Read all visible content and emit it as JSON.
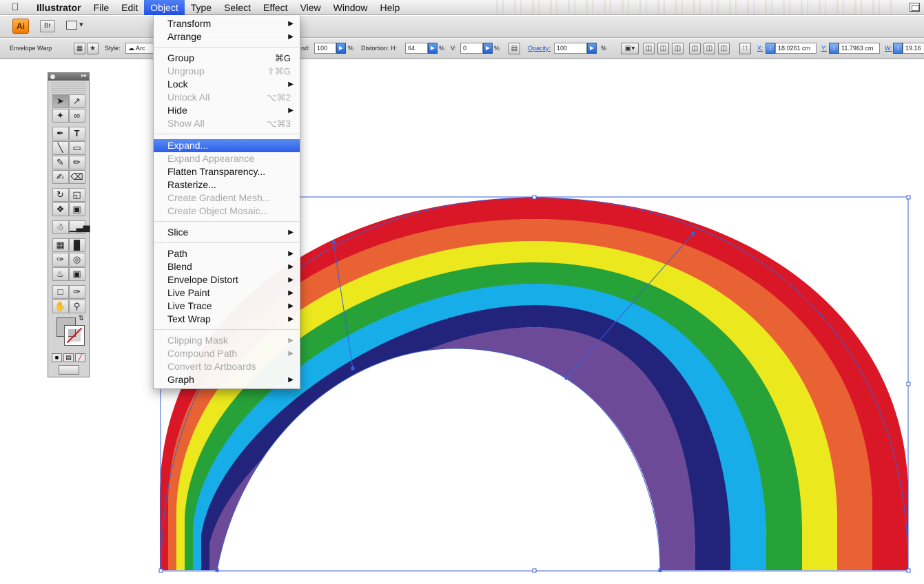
{
  "menubar": {
    "app_name": "Illustrator",
    "items": [
      "File",
      "Edit",
      "Object",
      "Type",
      "Select",
      "Effect",
      "View",
      "Window",
      "Help"
    ],
    "active": "Object"
  },
  "appbar": {
    "ai_label": "Ai",
    "bridge_label": "Br"
  },
  "controlbar": {
    "mode_label": "Envelope Warp",
    "style_label": "Style:",
    "style_value": "Arc",
    "bend_label": "nd:",
    "bend_value": "100",
    "distortion_h_label": "Distortion: H:",
    "distortion_h_value": "64",
    "v_label": "V:",
    "v_value": "0",
    "opacity_label": "Opacity:",
    "opacity_value": "100",
    "percent": "%",
    "x_label": "X:",
    "x_value": "18.0261 cm",
    "y_label": "Y:",
    "y_value": "11.7963 cm",
    "w_label": "W:",
    "w_value": "19.16"
  },
  "object_menu": {
    "items": [
      {
        "label": "Transform",
        "shortcut": "",
        "submenu": true,
        "disabled": false
      },
      {
        "label": "Arrange",
        "shortcut": "",
        "submenu": true,
        "disabled": false
      },
      {
        "label": "Group",
        "shortcut": "⌘G",
        "submenu": false,
        "disabled": false
      },
      {
        "label": "Ungroup",
        "shortcut": "⇧⌘G",
        "submenu": false,
        "disabled": true
      },
      {
        "label": "Lock",
        "shortcut": "",
        "submenu": true,
        "disabled": false
      },
      {
        "label": "Unlock All",
        "shortcut": "⌥⌘2",
        "submenu": false,
        "disabled": true
      },
      {
        "label": "Hide",
        "shortcut": "",
        "submenu": true,
        "disabled": false
      },
      {
        "label": "Show All",
        "shortcut": "⌥⌘3",
        "submenu": false,
        "disabled": true
      },
      {
        "label": "Expand...",
        "shortcut": "",
        "submenu": false,
        "disabled": false,
        "highlighted": true
      },
      {
        "label": "Expand Appearance",
        "shortcut": "",
        "submenu": false,
        "disabled": true
      },
      {
        "label": "Flatten Transparency...",
        "shortcut": "",
        "submenu": false,
        "disabled": false
      },
      {
        "label": "Rasterize...",
        "shortcut": "",
        "submenu": false,
        "disabled": false
      },
      {
        "label": "Create Gradient Mesh...",
        "shortcut": "",
        "submenu": false,
        "disabled": true
      },
      {
        "label": "Create Object Mosaic...",
        "shortcut": "",
        "submenu": false,
        "disabled": true
      },
      {
        "label": "Slice",
        "shortcut": "",
        "submenu": true,
        "disabled": false
      },
      {
        "label": "Path",
        "shortcut": "",
        "submenu": true,
        "disabled": false
      },
      {
        "label": "Blend",
        "shortcut": "",
        "submenu": true,
        "disabled": false
      },
      {
        "label": "Envelope Distort",
        "shortcut": "",
        "submenu": true,
        "disabled": false
      },
      {
        "label": "Live Paint",
        "shortcut": "",
        "submenu": true,
        "disabled": false
      },
      {
        "label": "Live Trace",
        "shortcut": "",
        "submenu": true,
        "disabled": false
      },
      {
        "label": "Text Wrap",
        "shortcut": "",
        "submenu": true,
        "disabled": false
      },
      {
        "label": "Clipping Mask",
        "shortcut": "",
        "submenu": true,
        "disabled": true
      },
      {
        "label": "Compound Path",
        "shortcut": "",
        "submenu": true,
        "disabled": true
      },
      {
        "label": "Convert to Artboards",
        "shortcut": "",
        "submenu": false,
        "disabled": true
      },
      {
        "label": "Graph",
        "shortcut": "",
        "submenu": true,
        "disabled": false
      }
    ]
  },
  "artwork": {
    "rainbow_colors": [
      "#da1727",
      "#e96233",
      "#ebe81e",
      "#27a239",
      "#17ade8",
      "#22237a",
      "#6d4a98"
    ],
    "selection_color": "#3a5fd8"
  },
  "tools_panel": {
    "type_tool_glyph": "T",
    "fill_color": "#bdbdbd",
    "stroke_color": "none"
  }
}
